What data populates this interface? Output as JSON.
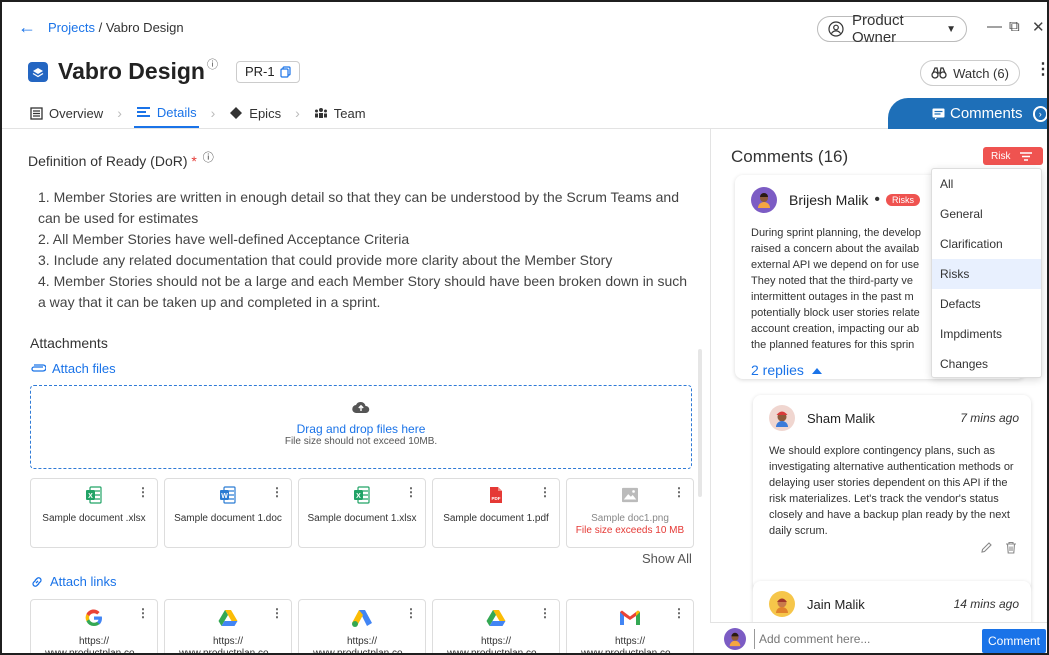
{
  "breadcrumb": {
    "projects": "Projects",
    "separator": "/",
    "current": "Vabro Design"
  },
  "role": {
    "label": "Product Owner"
  },
  "window": {
    "minimize": "—",
    "restore": "⧉",
    "close": "✕"
  },
  "project": {
    "title": "Vabro Design",
    "info": "ⓘ",
    "id": "PR-1"
  },
  "watch": {
    "label": "Watch (6)"
  },
  "tabs": [
    {
      "label": "Overview"
    },
    {
      "label": "Details"
    },
    {
      "label": "Epics"
    },
    {
      "label": "Team"
    }
  ],
  "comments_button": {
    "label": "Comments"
  },
  "dor": {
    "title": "Definition of Ready (DoR)",
    "required": "*",
    "info": "ⓘ",
    "items": [
      "1. Member Stories are written in enough detail so that they can be understood by the Scrum Teams and can be used for estimates",
      "2. All Member Stories have well-defined Acceptance Criteria",
      "3. Include any related documentation that could provide more clarity about the Member Story",
      "4. Member Stories should not be a large and each Member Story should have been broken down in such a way that it can be taken up and completed in a sprint."
    ]
  },
  "attachments": {
    "title": "Attachments",
    "attach_files": "Attach files",
    "drop_title": "Drag and drop files here",
    "drop_hint": "File size should not exceed 10MB.",
    "files": [
      {
        "name": "Sample document .xlsx",
        "icon": "excel-icon",
        "color": "#21a366"
      },
      {
        "name": "Sample document 1.doc",
        "icon": "word-icon",
        "color": "#2b7cd3"
      },
      {
        "name": "Sample document 1.xlsx",
        "icon": "excel-icon",
        "color": "#21a366"
      },
      {
        "name": "Sample document 1.pdf",
        "icon": "pdf-icon",
        "color": "#e53935"
      },
      {
        "name": "Sample doc1.png",
        "error": "File size exceeds 10 MB",
        "icon": "image-icon",
        "color": "#bbbbbb"
      }
    ],
    "show_all": "Show All",
    "attach_links": "Attach links",
    "links": [
      {
        "url": "https://\nwww.productplan.co...",
        "icon": "google-icon"
      },
      {
        "url": "https://\nwww.productplan.co...",
        "icon": "google-drive-icon"
      },
      {
        "url": "https://\nwww.productplan.co...",
        "icon": "google-ads-icon"
      },
      {
        "url": "https://\nwww.productplan.co...",
        "icon": "google-drive-icon"
      },
      {
        "url": "https://\nwww.productplan.co...",
        "icon": "gmail-icon"
      }
    ]
  },
  "comments": {
    "title": "Comments (16)",
    "filter_label": "Risk",
    "filter_options": [
      "All",
      "General",
      "Clarification",
      "Risks",
      "Defacts",
      "Impdiments",
      "Changes"
    ],
    "filter_selected": "Risks",
    "main": {
      "author": "Brijesh Malik",
      "dot": "•",
      "tag": "Risks",
      "lines": [
        "During sprint planning, the develop",
        "raised a concern about the availab",
        "external API we depend on for use",
        "They noted that the third-party ve",
        "intermittent outages in the past m",
        "potentially block user stories relate",
        "account creation, impacting our ab",
        "the planned features for this sprin"
      ],
      "replies": "2 replies"
    },
    "replies": [
      {
        "author": "Sham Malik",
        "time": "7 mins ago",
        "body": "We should explore contingency plans, such as investigating alternative authentication methods or delaying user stories dependent on this API if the risk materializes. Let's track the vendor's status closely and have a backup plan ready by the next daily scrum."
      },
      {
        "author": "Jain Malik",
        "time": "14 mins ago"
      }
    ],
    "input_placeholder": "Add comment here...",
    "submit": "Comment"
  },
  "colors": {
    "accent": "#1a73e8",
    "risk": "#ef5350",
    "comments_tab": "#1e6fb8"
  }
}
